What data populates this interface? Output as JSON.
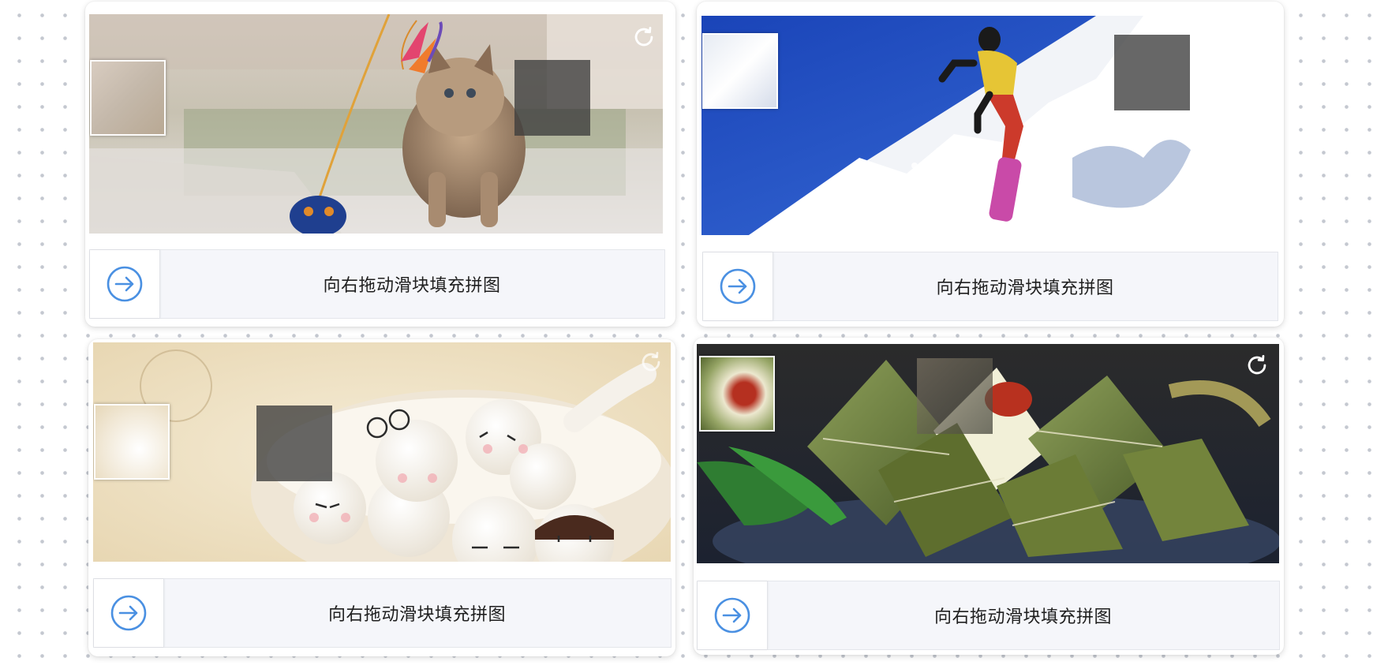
{
  "colors": {
    "accent": "#4a90e2",
    "track_bg": "#f5f6fa",
    "hole": "#3c3c3c"
  },
  "cards": [
    {
      "image_subject": "kitten playing with feather toy",
      "refresh_icon": "refresh-icon",
      "slider_icon": "arrow-right-circle-icon",
      "hint": "向右拖动滑块填充拼图"
    },
    {
      "image_subject": "snowboarder on snowy slope",
      "refresh_icon": "refresh-icon",
      "slider_icon": "arrow-right-circle-icon",
      "hint": "向右拖动滑块填充拼图"
    },
    {
      "image_subject": "cartoon tangyuan dumplings in bowl",
      "refresh_icon": "refresh-icon",
      "slider_icon": "arrow-right-circle-icon",
      "hint": "向右拖动滑块填充拼图"
    },
    {
      "image_subject": "zongzi rice dumplings in leaves",
      "refresh_icon": "refresh-icon",
      "slider_icon": "arrow-right-circle-icon",
      "hint": "向右拖动滑块填充拼图"
    }
  ]
}
